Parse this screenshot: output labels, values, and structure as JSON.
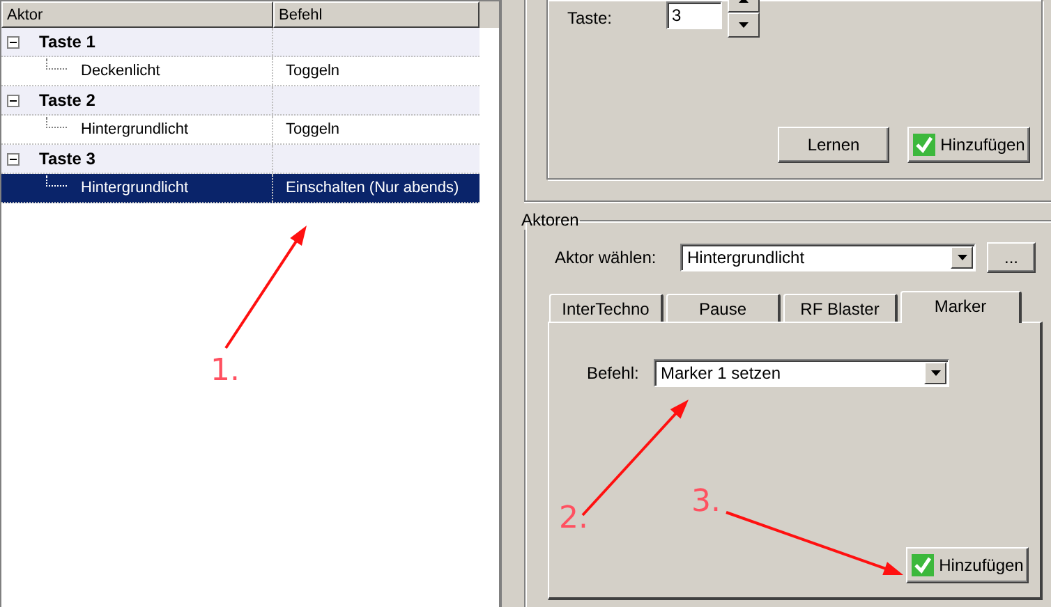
{
  "tree": {
    "columns": [
      "Aktor",
      "Befehl"
    ],
    "groups": [
      {
        "label": "Taste 1",
        "expanded": true,
        "children": [
          {
            "aktor": "Deckenlicht",
            "befehl": "Toggeln",
            "selected": false
          }
        ]
      },
      {
        "label": "Taste 2",
        "expanded": true,
        "children": [
          {
            "aktor": "Hintergrundlicht",
            "befehl": "Toggeln",
            "selected": false
          }
        ]
      },
      {
        "label": "Taste 3",
        "expanded": true,
        "children": [
          {
            "aktor": "Hintergrundlicht",
            "befehl": "Einschalten (Nur abends)",
            "selected": true
          }
        ]
      }
    ]
  },
  "taste": {
    "label": "Taste:",
    "value": "3",
    "buttons": [
      {
        "label": "Lernen",
        "kind": "plain"
      },
      {
        "label": "Hinzufügen",
        "kind": "check"
      }
    ]
  },
  "aktoren": {
    "title": "Aktoren",
    "aktor_label": "Aktor wählen:",
    "aktor_value": "Hintergrundlicht",
    "more_button": "...",
    "tabs": [
      {
        "label": "InterTechno",
        "selected": false
      },
      {
        "label": "Pause",
        "selected": false
      },
      {
        "label": "RF Blaster",
        "selected": false
      },
      {
        "label": "Marker",
        "selected": true
      }
    ],
    "befehl_label": "Befehl:",
    "befehl_value": "Marker 1 setzen",
    "add_button": "Hinzufügen"
  },
  "annotations": [
    "1.",
    "2.",
    "3."
  ]
}
